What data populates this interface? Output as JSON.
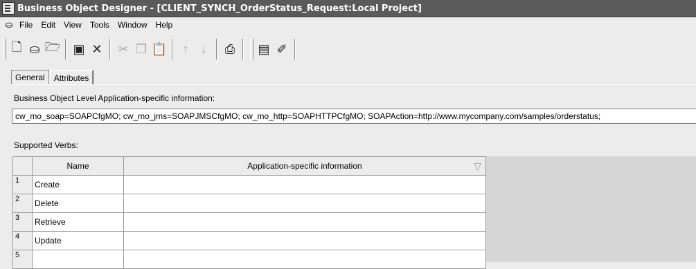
{
  "window": {
    "title": "Business Object Designer - [CLIENT_SYNCH_OrderStatus_Request:Local Project]"
  },
  "menu": [
    "File",
    "Edit",
    "View",
    "Tools",
    "Window",
    "Help"
  ],
  "toolbar": {
    "buttons": [
      {
        "icon": "new-document-icon",
        "glyph": "🗋",
        "enabled": true
      },
      {
        "icon": "open-project-icon",
        "glyph": "⛀",
        "enabled": true
      },
      {
        "icon": "open-folder-icon",
        "glyph": "🗁",
        "enabled": true
      },
      {
        "icon": "save-icon",
        "glyph": "▣",
        "enabled": true
      },
      {
        "icon": "delete-icon",
        "glyph": "✕",
        "enabled": true
      },
      {
        "icon": "cut-icon",
        "glyph": "✂",
        "enabled": false
      },
      {
        "icon": "copy-icon",
        "glyph": "❐",
        "enabled": false
      },
      {
        "icon": "paste-icon",
        "glyph": "📋",
        "enabled": true
      },
      {
        "icon": "move-up-icon",
        "glyph": "↑",
        "enabled": false
      },
      {
        "icon": "move-down-icon",
        "glyph": "↓",
        "enabled": false
      },
      {
        "icon": "print-icon",
        "glyph": "⎙",
        "enabled": true
      },
      {
        "icon": "properties-icon",
        "glyph": "▤",
        "enabled": true
      },
      {
        "icon": "wizard-icon",
        "glyph": "✐",
        "enabled": true
      }
    ]
  },
  "tabs": [
    {
      "label": "General",
      "active": false
    },
    {
      "label": "Attributes",
      "active": true
    }
  ],
  "business_object": {
    "label": "Business Object Level Application-specific information:",
    "value": "cw_mo_soap=SOAPCfgMO; cw_mo_jms=SOAPJMSCfgMO; cw_mo_http=SOAPHTTPCfgMO; SOAPAction=http://www.mycompany.com/samples/orderstatus;"
  },
  "verbs": {
    "label": "Supported Verbs:",
    "columns": [
      "Name",
      "Application-specific information"
    ],
    "rows": [
      {
        "num": "1",
        "name": "Create",
        "info": ""
      },
      {
        "num": "2",
        "name": "Delete",
        "info": ""
      },
      {
        "num": "3",
        "name": "Retrieve",
        "info": ""
      },
      {
        "num": "4",
        "name": "Update",
        "info": ""
      },
      {
        "num": "5",
        "name": "",
        "info": ""
      }
    ]
  }
}
